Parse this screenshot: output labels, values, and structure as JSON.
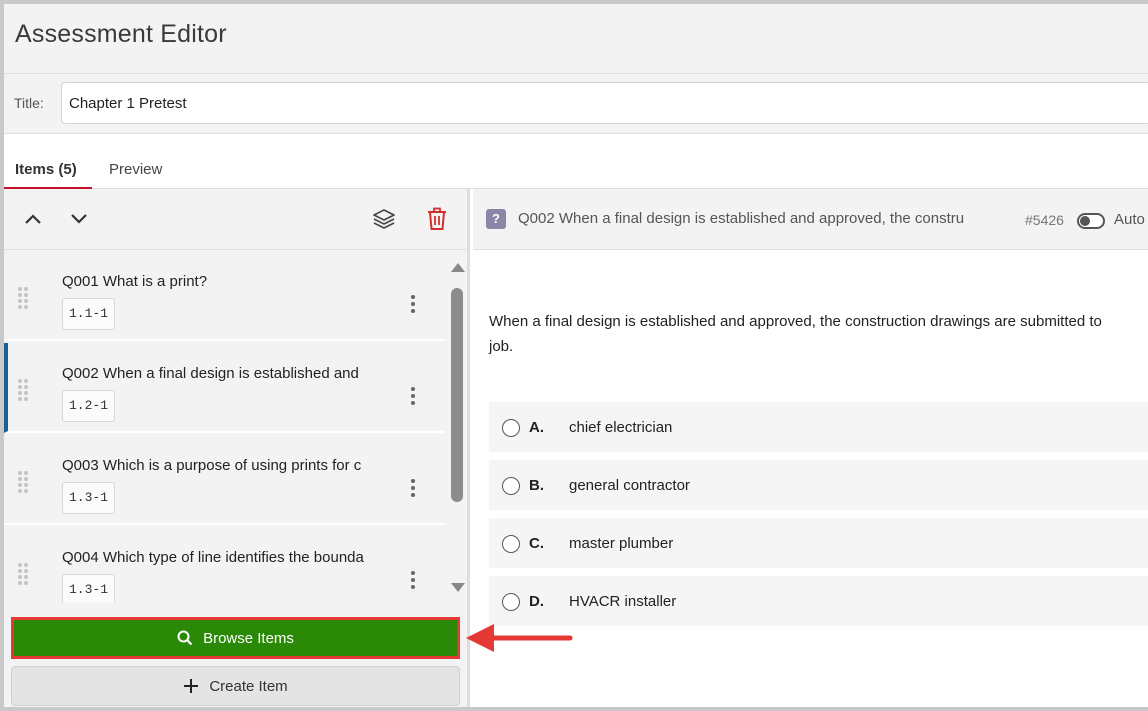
{
  "header": {
    "title": "Assessment Editor"
  },
  "title_field": {
    "label": "Title:",
    "value": "Chapter 1 Pretest"
  },
  "tabs": [
    {
      "label": "Items (5)",
      "active": true
    },
    {
      "label": "Preview",
      "active": false
    }
  ],
  "toolbar": {
    "icons": [
      "chevron-up-icon",
      "chevron-down-icon",
      "layers-icon",
      "trash-icon"
    ]
  },
  "items": [
    {
      "title": "Q001 What is a print?",
      "code": "1.1-1",
      "selected": false
    },
    {
      "title": "Q002 When a final design is established and",
      "code": "1.2-1",
      "selected": true
    },
    {
      "title": "Q003 Which is a purpose of using prints for c",
      "code": "1.3-1",
      "selected": false
    },
    {
      "title": "Q004 Which type of line identifies the bounda",
      "code": "1.3-1",
      "selected": false
    }
  ],
  "buttons": {
    "browse": "Browse Items",
    "create": "Create Item"
  },
  "question": {
    "badge": "?",
    "header_title": "Q002 When a final design is established and approved, the constru",
    "id": "#5426",
    "auto_label": "Auto",
    "stem_line1": "When a final design is established and approved, the construction drawings are submitted to",
    "stem_line2": "job.",
    "choices": [
      {
        "letter": "A.",
        "text": "chief electrician"
      },
      {
        "letter": "B.",
        "text": "general contractor"
      },
      {
        "letter": "C.",
        "text": "master plumber"
      },
      {
        "letter": "D.",
        "text": "HVACR installer"
      }
    ]
  },
  "colors": {
    "browse_green": "#2a8a07",
    "highlight_red": "#e53935",
    "tab_underline": "#c8102e",
    "selected_bar": "#1b5e96"
  }
}
